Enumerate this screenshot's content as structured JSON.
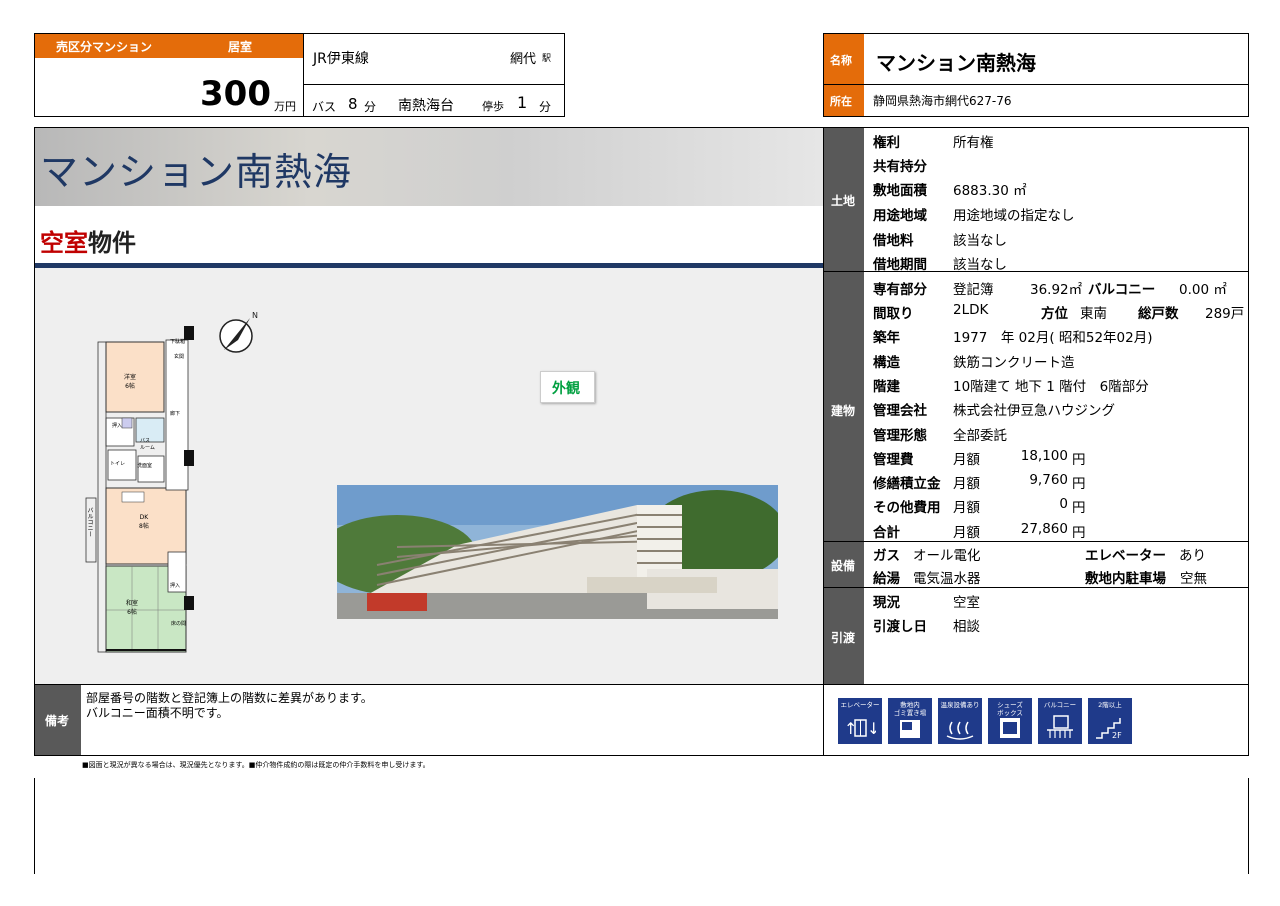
{
  "top": {
    "category": "売区分マンション",
    "room_status": "居室",
    "price_value": "300",
    "price_unit": "万円",
    "line": "JR伊東線",
    "station": "網代",
    "station_suffix": "駅",
    "bus_label": "バス",
    "bus_min": "8",
    "min_unit": "分",
    "bus_stop": "南熱海台",
    "walk_label": "停歩",
    "walk_min": "1",
    "name_label": "名称",
    "name_value": "マンション南熱海",
    "addr_label": "所在",
    "addr_value": "静岡県熱海市網代627-76"
  },
  "banner": {
    "title": "マンション南熱海",
    "sub_red": "空室",
    "sub_black": "物件",
    "exterior_label": "外観"
  },
  "floorplan": {
    "western_room": "洋室\n6帖",
    "dk": "DK\n8帖",
    "japanese_room": "和室\n6帖",
    "balcony": "バルコニー",
    "entrance": "玄関",
    "hallway": "廊下",
    "closet": "押入",
    "bath": "バス\nルーム",
    "toilet": "トイレ",
    "washroom": "洗面室",
    "storage": "下駄箱",
    "tokonoma": "床の間"
  },
  "land": {
    "label": "土地",
    "rows": [
      {
        "k": "権利",
        "v": "所有権"
      },
      {
        "k": "共有持分",
        "v": ""
      },
      {
        "k": "敷地面積",
        "v": "6883.30 ㎡"
      },
      {
        "k": "用途地域",
        "v": "用途地域の指定なし"
      },
      {
        "k": "借地料",
        "v": "該当なし"
      },
      {
        "k": "借地期間",
        "v": "該当なし"
      }
    ]
  },
  "building": {
    "label": "建物",
    "exclusive_k": "専有部分",
    "exclusive_reg": "登記簿",
    "exclusive_area": "36.92㎡",
    "balcony_k": "バルコニー",
    "balcony_v": "0.00 ㎡",
    "layout_k": "間取り",
    "layout_v": "2LDK",
    "direction_k": "方位",
    "direction_v": "東南",
    "units_k": "総戸数",
    "units_v": "289戸",
    "built_k": "築年",
    "built_v": "1977　年 02月( 昭和52年02月)",
    "structure_k": "構造",
    "structure_v": "鉄筋コンクリート造",
    "floors_k": "階建",
    "floors_v": "10階建て 地下 1 階付　6階部分",
    "mgmt_co_k": "管理会社",
    "mgmt_co_v": "株式会社伊豆急ハウジング",
    "mgmt_type_k": "管理形態",
    "mgmt_type_v": "全部委託",
    "fees": [
      {
        "k": "管理費",
        "period": "月額",
        "amount": "18,100",
        "unit": "円"
      },
      {
        "k": "修繕積立金",
        "period": "月額",
        "amount": "9,760",
        "unit": "円"
      },
      {
        "k": "その他費用",
        "period": "月額",
        "amount": "0",
        "unit": "円"
      },
      {
        "k": "合計",
        "period": "月額",
        "amount": "27,860",
        "unit": "円"
      }
    ]
  },
  "equipment": {
    "label": "設備",
    "gas_k": "ガス",
    "gas_v": "オール電化",
    "elevator_k": "エレベーター",
    "elevator_v": "あり",
    "water_k": "給湯",
    "water_v": "電気温水器",
    "parking_k": "敷地内駐車場",
    "parking_v": "空無"
  },
  "handover": {
    "label": "引渡",
    "status_k": "現況",
    "status_v": "空室",
    "date_k": "引渡し日",
    "date_v": "相談"
  },
  "remarks": {
    "label": "備考",
    "line1": "部屋番号の階数と登記簿上の階数に差異があります。",
    "line2": "バルコニー面積不明です。"
  },
  "icons": [
    {
      "name": "elevator-icon",
      "caption": "エレベーター"
    },
    {
      "name": "garbage-icon",
      "caption": "敷地内\nゴミ置き場"
    },
    {
      "name": "hot-spring-icon",
      "caption": "温泉設備あり"
    },
    {
      "name": "shoe-box-icon",
      "caption": "シューズ\nボックス"
    },
    {
      "name": "balcony-icon",
      "caption": "バルコニー"
    },
    {
      "name": "upper-floor-icon",
      "caption": "2階以上"
    }
  ],
  "footnote": "■図面と現況が異なる場合は、現況優先となります。■仲介物件成約の際は既定の仲介手数料を申し受けます。",
  "colors": {
    "accent": "#e46c0a",
    "label_bg": "#595959",
    "title_navy": "#1f3864",
    "red": "#c00000",
    "icon_blue": "#1f3a8a"
  }
}
